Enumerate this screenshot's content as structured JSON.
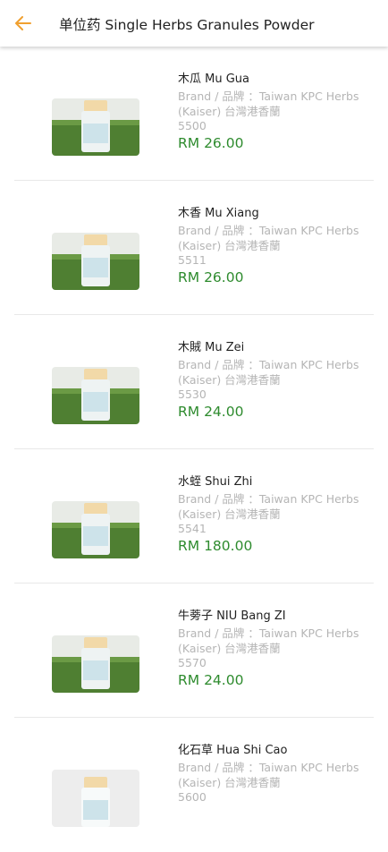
{
  "header": {
    "back_icon": "arrow-left-icon",
    "title": "单位药 Single Herbs Granules Powder",
    "accent_color": "#f0a030"
  },
  "products": [
    {
      "name": "木瓜 Mu Gua",
      "brand": "Brand / 品牌 ：Taiwan KPC Herbs (Kaiser) 台灣港香蘭",
      "code": "5500",
      "price": "RM 26.00",
      "background": "grass"
    },
    {
      "name": "木香 Mu Xiang",
      "brand": "Brand / 品牌 ：Taiwan KPC Herbs (Kaiser) 台灣港香蘭",
      "code": "5511",
      "price": "RM 26.00",
      "background": "grass"
    },
    {
      "name": "木賊 Mu Zei",
      "brand": "Brand / 品牌 ：Taiwan KPC Herbs (Kaiser) 台灣港香蘭",
      "code": "5530",
      "price": "RM 24.00",
      "background": "grass"
    },
    {
      "name": "水蛭 Shui Zhi",
      "brand": "Brand / 品牌 ：Taiwan KPC Herbs (Kaiser) 台灣港香蘭",
      "code": "5541",
      "price": "RM 180.00",
      "background": "grass"
    },
    {
      "name": "牛蒡子 NIU Bang ZI",
      "brand": "Brand / 品牌 ：Taiwan KPC Herbs (Kaiser) 台灣港香蘭",
      "code": "5570",
      "price": "RM 24.00",
      "background": "grass"
    },
    {
      "name": "化石草 Hua Shi Cao",
      "brand": "Brand / 品牌 ：Taiwan KPC Herbs (Kaiser) 台灣港香蘭",
      "code": "5600",
      "price": "",
      "background": "white"
    }
  ],
  "colors": {
    "price": "#2e8b2e",
    "muted": "#b5b5b5"
  }
}
